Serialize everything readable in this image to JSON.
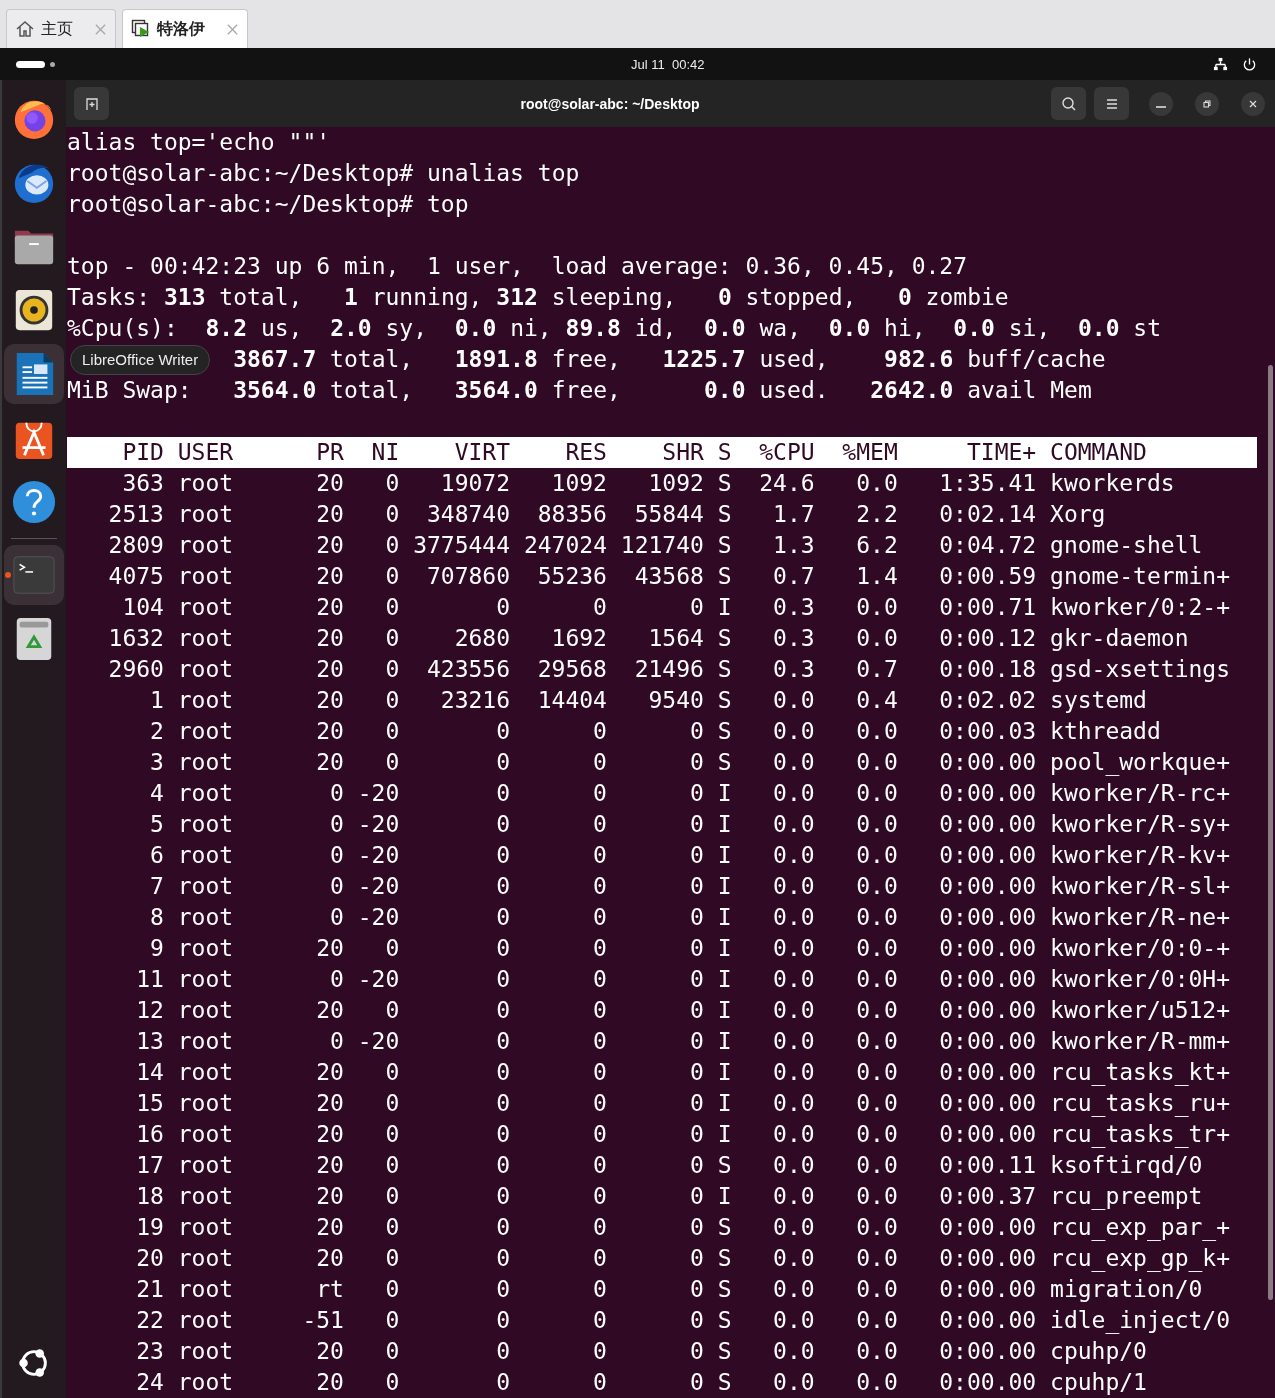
{
  "browser_tabs": [
    {
      "label": "主页",
      "kind": "home",
      "selected": false
    },
    {
      "label": "特洛伊",
      "kind": "remote",
      "selected": true
    }
  ],
  "panel": {
    "clock": "Jul 11  00:42"
  },
  "dock": {
    "apps": [
      {
        "kind": "firefox",
        "highlighted": false,
        "running": false
      },
      {
        "kind": "thunderbird",
        "highlighted": false,
        "running": false
      },
      {
        "kind": "files",
        "highlighted": false,
        "running": false
      },
      {
        "kind": "rhythmbox",
        "highlighted": false,
        "running": false
      },
      {
        "kind": "writer",
        "highlighted": true,
        "running": false
      },
      {
        "kind": "appcenter",
        "highlighted": false,
        "running": false
      },
      {
        "kind": "help",
        "highlighted": false,
        "running": false
      }
    ],
    "apps_below": [
      {
        "kind": "terminal",
        "highlighted": true,
        "running": true
      },
      {
        "kind": "trash",
        "highlighted": false,
        "running": false
      }
    ],
    "tooltip": "LibreOffice Writer"
  },
  "terminal": {
    "title": "root@solar-abc: ~/Desktop",
    "lines": [
      "alias top='echo \"\"'",
      "root@solar-abc:~/Desktop# unalias top",
      "root@solar-abc:~/Desktop# top"
    ],
    "summary": [
      {
        "text": "top - 00:42:23 up 6 min,  1 user,  load average: 0.36, 0.45, 0.27"
      },
      {
        "text": "Tasks: **313** total,   **1** running, **312** sleeping,   **0** stopped,   **0** zombie"
      },
      {
        "text": "%Cpu(s):  **8.2** us,  **2.0** sy,  **0.0** ni, **89.8** id,  **0.0** wa,  **0.0** hi,  **0.0** si,  **0.0** st"
      },
      {
        "indent": true,
        "text": "**3867.7** total,   **1891.8** free,   **1225.7** used,    **982.6** buff/cache"
      },
      {
        "text": "MiB Swap:   **3564.0** total,   **3564.0** free,      **0.0** used.   **2642.0** avail Mem"
      }
    ],
    "columns": [
      "PID",
      "USER",
      "PR",
      "NI",
      "VIRT",
      "RES",
      "SHR",
      "S",
      "%CPU",
      "%MEM",
      "TIME+",
      "COMMAND"
    ],
    "rows": [
      [
        "363",
        "root",
        "20",
        "0",
        "19072",
        "1092",
        "1092",
        "S",
        "24.6",
        "0.0",
        "1:35.41",
        "kworkerds"
      ],
      [
        "2513",
        "root",
        "20",
        "0",
        "348740",
        "88356",
        "55844",
        "S",
        "1.7",
        "2.2",
        "0:02.14",
        "Xorg"
      ],
      [
        "2809",
        "root",
        "20",
        "0",
        "3775444",
        "247024",
        "121740",
        "S",
        "1.3",
        "6.2",
        "0:04.72",
        "gnome-shell"
      ],
      [
        "4075",
        "root",
        "20",
        "0",
        "707860",
        "55236",
        "43568",
        "S",
        "0.7",
        "1.4",
        "0:00.59",
        "gnome-termin+"
      ],
      [
        "104",
        "root",
        "20",
        "0",
        "0",
        "0",
        "0",
        "I",
        "0.3",
        "0.0",
        "0:00.71",
        "kworker/0:2-+"
      ],
      [
        "1632",
        "root",
        "20",
        "0",
        "2680",
        "1692",
        "1564",
        "S",
        "0.3",
        "0.0",
        "0:00.12",
        "gkr-daemon"
      ],
      [
        "2960",
        "root",
        "20",
        "0",
        "423556",
        "29568",
        "21496",
        "S",
        "0.3",
        "0.7",
        "0:00.18",
        "gsd-xsettings"
      ],
      [
        "1",
        "root",
        "20",
        "0",
        "23216",
        "14404",
        "9540",
        "S",
        "0.0",
        "0.4",
        "0:02.02",
        "systemd"
      ],
      [
        "2",
        "root",
        "20",
        "0",
        "0",
        "0",
        "0",
        "S",
        "0.0",
        "0.0",
        "0:00.03",
        "kthreadd"
      ],
      [
        "3",
        "root",
        "20",
        "0",
        "0",
        "0",
        "0",
        "S",
        "0.0",
        "0.0",
        "0:00.00",
        "pool_workque+"
      ],
      [
        "4",
        "root",
        "0",
        "-20",
        "0",
        "0",
        "0",
        "I",
        "0.0",
        "0.0",
        "0:00.00",
        "kworker/R-rc+"
      ],
      [
        "5",
        "root",
        "0",
        "-20",
        "0",
        "0",
        "0",
        "I",
        "0.0",
        "0.0",
        "0:00.00",
        "kworker/R-sy+"
      ],
      [
        "6",
        "root",
        "0",
        "-20",
        "0",
        "0",
        "0",
        "I",
        "0.0",
        "0.0",
        "0:00.00",
        "kworker/R-kv+"
      ],
      [
        "7",
        "root",
        "0",
        "-20",
        "0",
        "0",
        "0",
        "I",
        "0.0",
        "0.0",
        "0:00.00",
        "kworker/R-sl+"
      ],
      [
        "8",
        "root",
        "0",
        "-20",
        "0",
        "0",
        "0",
        "I",
        "0.0",
        "0.0",
        "0:00.00",
        "kworker/R-ne+"
      ],
      [
        "9",
        "root",
        "20",
        "0",
        "0",
        "0",
        "0",
        "I",
        "0.0",
        "0.0",
        "0:00.00",
        "kworker/0:0-+"
      ],
      [
        "11",
        "root",
        "0",
        "-20",
        "0",
        "0",
        "0",
        "I",
        "0.0",
        "0.0",
        "0:00.00",
        "kworker/0:0H+"
      ],
      [
        "12",
        "root",
        "20",
        "0",
        "0",
        "0",
        "0",
        "I",
        "0.0",
        "0.0",
        "0:00.00",
        "kworker/u512+"
      ],
      [
        "13",
        "root",
        "0",
        "-20",
        "0",
        "0",
        "0",
        "I",
        "0.0",
        "0.0",
        "0:00.00",
        "kworker/R-mm+"
      ],
      [
        "14",
        "root",
        "20",
        "0",
        "0",
        "0",
        "0",
        "I",
        "0.0",
        "0.0",
        "0:00.00",
        "rcu_tasks_kt+"
      ],
      [
        "15",
        "root",
        "20",
        "0",
        "0",
        "0",
        "0",
        "I",
        "0.0",
        "0.0",
        "0:00.00",
        "rcu_tasks_ru+"
      ],
      [
        "16",
        "root",
        "20",
        "0",
        "0",
        "0",
        "0",
        "I",
        "0.0",
        "0.0",
        "0:00.00",
        "rcu_tasks_tr+"
      ],
      [
        "17",
        "root",
        "20",
        "0",
        "0",
        "0",
        "0",
        "S",
        "0.0",
        "0.0",
        "0:00.11",
        "ksoftirqd/0"
      ],
      [
        "18",
        "root",
        "20",
        "0",
        "0",
        "0",
        "0",
        "I",
        "0.0",
        "0.0",
        "0:00.37",
        "rcu_preempt"
      ],
      [
        "19",
        "root",
        "20",
        "0",
        "0",
        "0",
        "0",
        "S",
        "0.0",
        "0.0",
        "0:00.00",
        "rcu_exp_par_+"
      ],
      [
        "20",
        "root",
        "20",
        "0",
        "0",
        "0",
        "0",
        "S",
        "0.0",
        "0.0",
        "0:00.00",
        "rcu_exp_gp_k+"
      ],
      [
        "21",
        "root",
        "rt",
        "0",
        "0",
        "0",
        "0",
        "S",
        "0.0",
        "0.0",
        "0:00.00",
        "migration/0"
      ],
      [
        "22",
        "root",
        "-51",
        "0",
        "0",
        "0",
        "0",
        "S",
        "0.0",
        "0.0",
        "0:00.00",
        "idle_inject/0"
      ],
      [
        "23",
        "root",
        "20",
        "0",
        "0",
        "0",
        "0",
        "S",
        "0.0",
        "0.0",
        "0:00.00",
        "cpuhp/0"
      ],
      [
        "24",
        "root",
        "20",
        "0",
        "0",
        "0",
        "0",
        "S",
        "0.0",
        "0.0",
        "0:00.00",
        "cpuhp/1"
      ]
    ]
  }
}
